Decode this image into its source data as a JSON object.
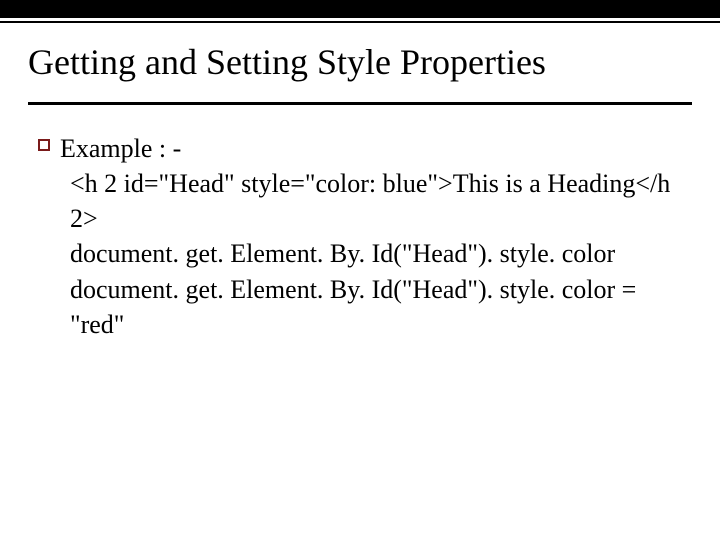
{
  "title": "Getting and Setting Style Properties",
  "content": {
    "bullet_label": "Example : -",
    "line1": "<h 2 id=\"Head\" style=\"color: blue\">This is a Heading</h 2>",
    "line2": "document. get. Element. By. Id(\"Head\"). style. color",
    "line3": "document. get. Element. By. Id(\"Head\"). style. color = \"red\""
  }
}
